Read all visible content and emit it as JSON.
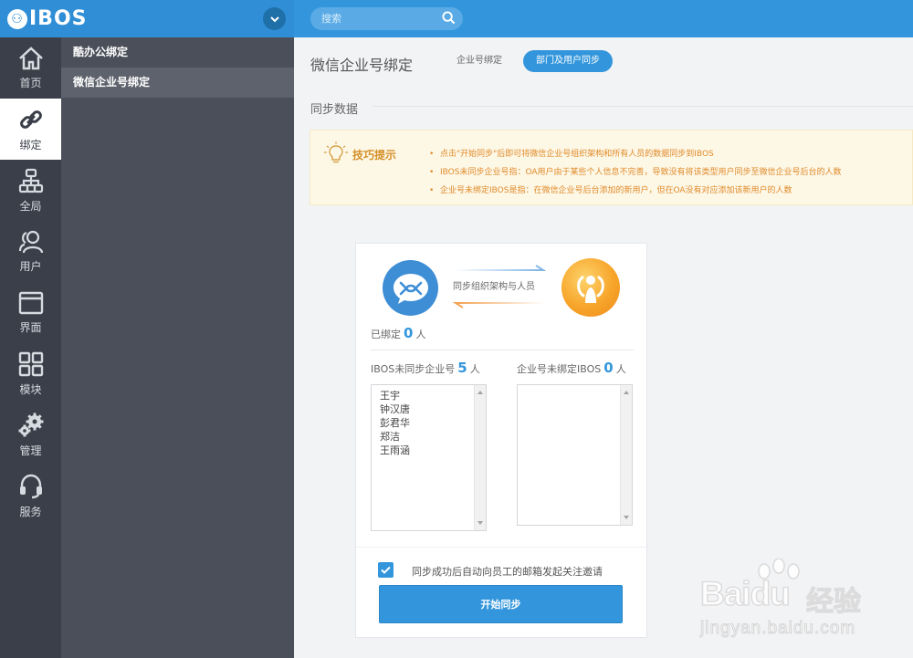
{
  "brand": {
    "logo_text": "IBOS"
  },
  "search": {
    "placeholder": "搜索"
  },
  "nav": {
    "items": [
      {
        "label": "首页",
        "icon": "home-icon"
      },
      {
        "label": "绑定",
        "icon": "link-icon",
        "active": true
      },
      {
        "label": "全局",
        "icon": "org-icon"
      },
      {
        "label": "用户",
        "icon": "users-icon"
      },
      {
        "label": "界面",
        "icon": "window-icon"
      },
      {
        "label": "模块",
        "icon": "grid-icon"
      },
      {
        "label": "管理",
        "icon": "gears-icon"
      },
      {
        "label": "服务",
        "icon": "headset-icon"
      }
    ]
  },
  "subnav": {
    "items": [
      {
        "label": "酷办公绑定"
      },
      {
        "label": "微信企业号绑定",
        "active": true
      }
    ]
  },
  "main": {
    "title": "微信企业号绑定",
    "tabs": [
      {
        "label": "企业号绑定"
      },
      {
        "label": "部门及用户同步",
        "active": true
      }
    ],
    "section_title": "同步数据",
    "tips": {
      "label": "技巧提示",
      "items": [
        "点击\"开始同步\"后即可将微信企业号组织架构和所有人员的数据同步到IBOS",
        "IBOS未同步企业号指：OA用户由于某些个人信息不完善，导致没有将该类型用户同步至微信企业号后台的人数",
        "企业号未绑定IBOS是指：在微信企业号后台添加的新用户，但在OA没有对应添加该新用户的人数"
      ]
    },
    "sync": {
      "center_label": "同步组织架构与人员",
      "bound_label": "已绑定",
      "bound_count": "0",
      "person_unit": "人",
      "ibos_unsynced_label": "IBOS未同步企业号",
      "ibos_unsynced_count": "5",
      "wx_unbound_label": "企业号未绑定IBOS",
      "wx_unbound_count": "0",
      "unsynced_users": [
        "王宇",
        "钟汉唐",
        "彭君华",
        "郑洁",
        "王雨涵"
      ],
      "auto_invite_label": "同步成功后自动向员工的邮箱发起关注邀请",
      "auto_invite_checked": true,
      "start_button": "开始同步"
    }
  },
  "watermark": {
    "brand": "Baidu",
    "cn": "经验",
    "url": "jingyan.baidu.com"
  },
  "colors": {
    "primary": "#3396dc",
    "sidebar": "#3b3f49",
    "subnav": "#4b4f59",
    "tip_text": "#e08b2b"
  }
}
